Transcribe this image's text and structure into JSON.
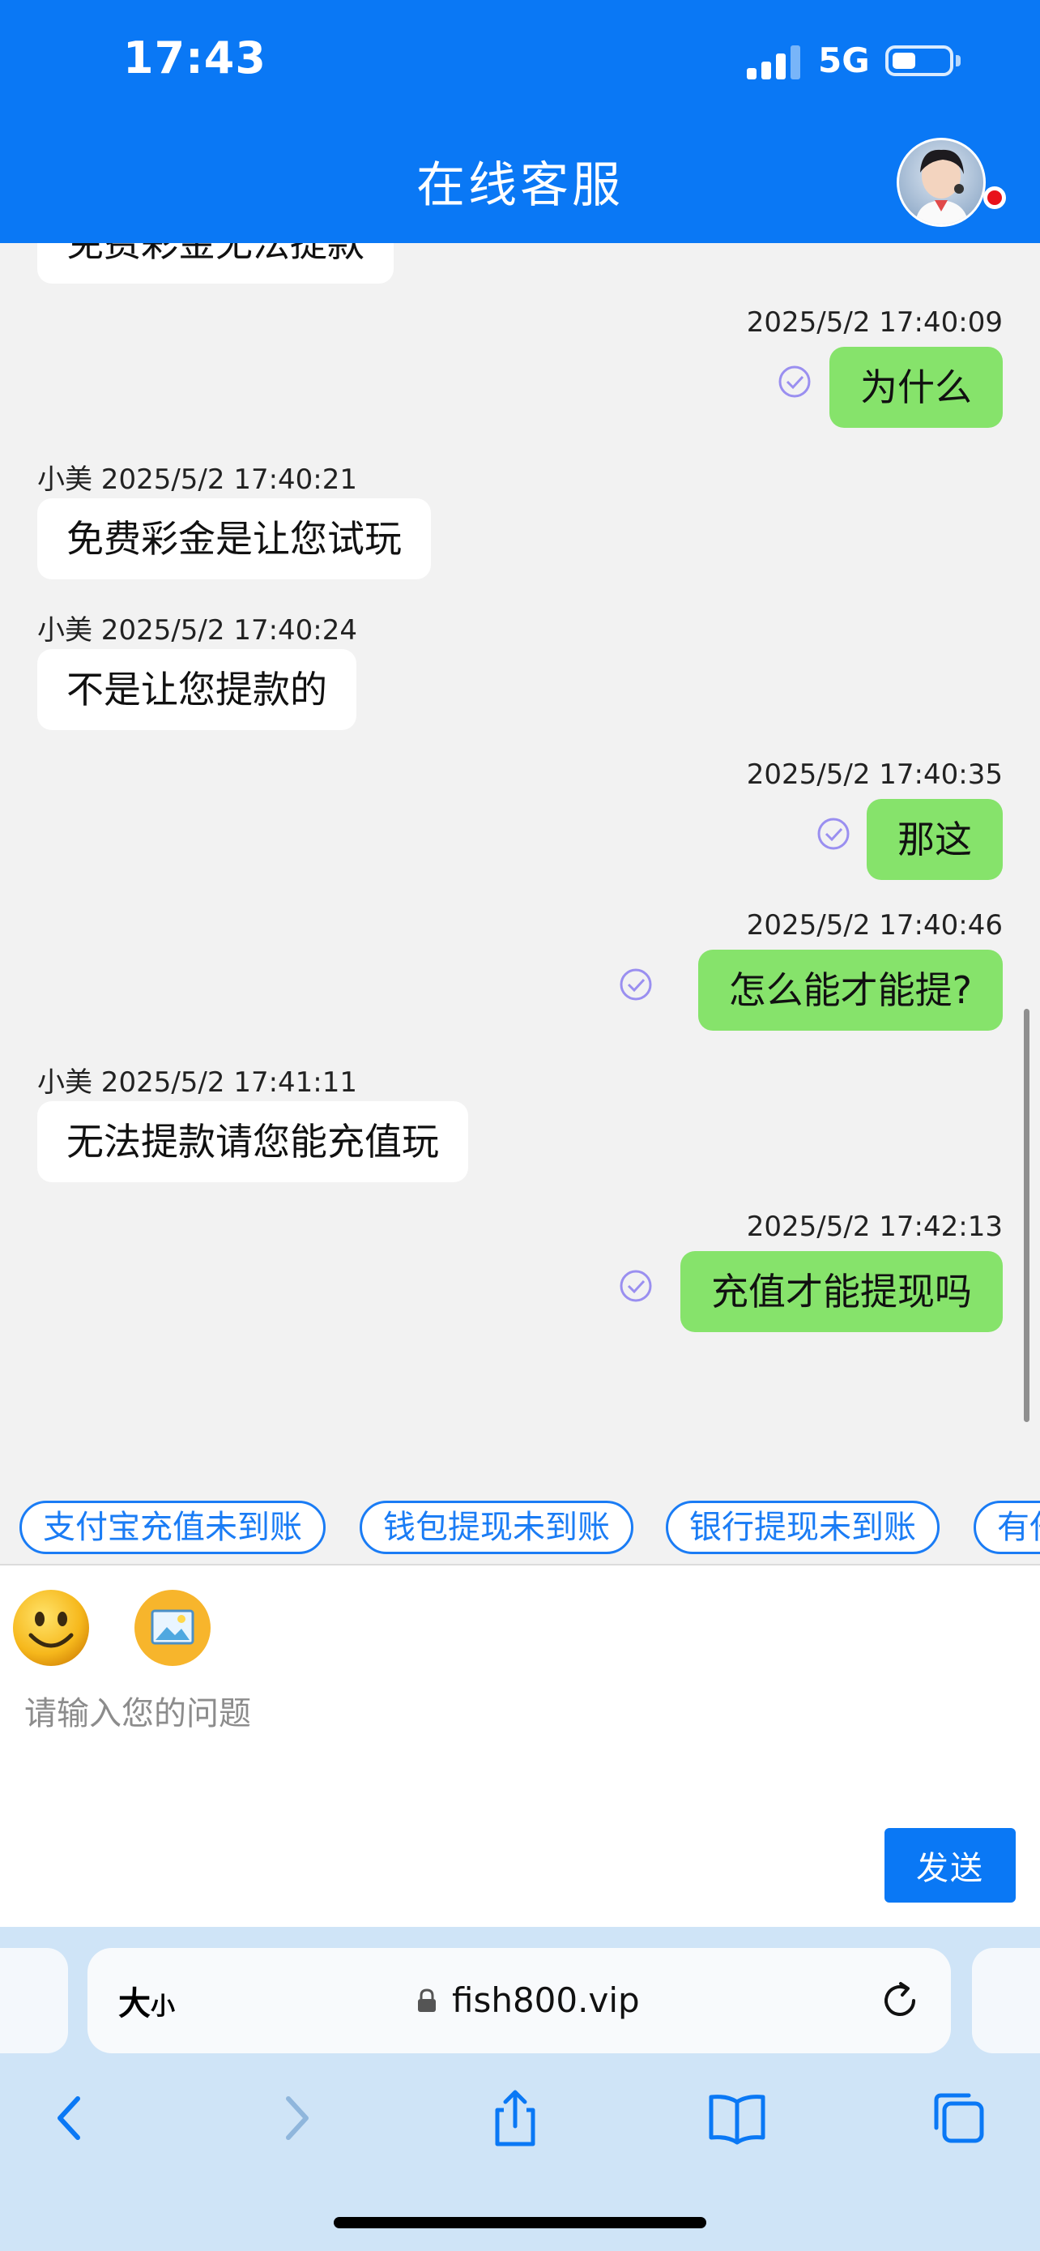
{
  "status_bar": {
    "time": "17:43",
    "network": "5G"
  },
  "header": {
    "title": "在线客服"
  },
  "chat": {
    "partial_top_message": "免费彩金无法提款",
    "messages": [
      {
        "direction": "out",
        "timestamp": "2025/5/2 17:40:09",
        "text": "为什么"
      },
      {
        "direction": "in",
        "sender_timestamp": "小美 2025/5/2 17:40:21",
        "text": "免费彩金是让您试玩"
      },
      {
        "direction": "in",
        "sender_timestamp": "小美 2025/5/2 17:40:24",
        "text": "不是让您提款的"
      },
      {
        "direction": "out",
        "timestamp": "2025/5/2 17:40:35",
        "text": "那这"
      },
      {
        "direction": "out",
        "timestamp": "2025/5/2 17:40:46",
        "text": "怎么能才能提?"
      },
      {
        "direction": "in",
        "sender_timestamp": "小美 2025/5/2 17:41:11",
        "text": "无法提款请您能充值玩"
      },
      {
        "direction": "out",
        "timestamp": "2025/5/2 17:42:13",
        "text": "充值才能提现吗"
      }
    ]
  },
  "quick_replies": [
    "支付宝充值未到账",
    "钱包提现未到账",
    "银行提现未到账",
    "有任"
  ],
  "input": {
    "placeholder": "请输入您的问题",
    "send_label": "发送"
  },
  "browser": {
    "text_size_big": "大",
    "text_size_small": "小",
    "url": "fish800.vip"
  },
  "colors": {
    "brand_blue": "#0a78f5",
    "outgoing_bubble": "#86e36b",
    "incoming_bubble": "#ffffff",
    "online_dot": "#e8121b"
  }
}
